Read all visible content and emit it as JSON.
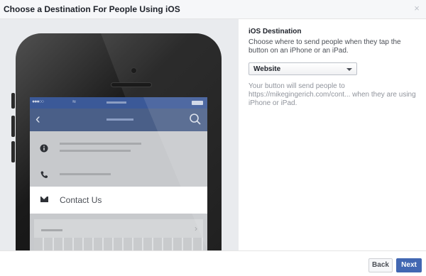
{
  "dialog": {
    "title": "Choose a Destination For People Using iOS",
    "close_icon": "×"
  },
  "preview": {
    "contact_label": "Contact Us"
  },
  "settings": {
    "section_title": "iOS Destination",
    "description": "Choose where to send people when they tap the button on an iPhone or an iPad.",
    "destination_select": {
      "selected": "Website"
    },
    "result_text": "Your button will send people to https://mikegingerich.com/cont... when they are using iPhone or iPad."
  },
  "footer": {
    "back_label": "Back",
    "next_label": "Next"
  },
  "colors": {
    "primary": "#4267b2",
    "nav_blue": "#3b5998",
    "muted_text": "#90949c"
  }
}
